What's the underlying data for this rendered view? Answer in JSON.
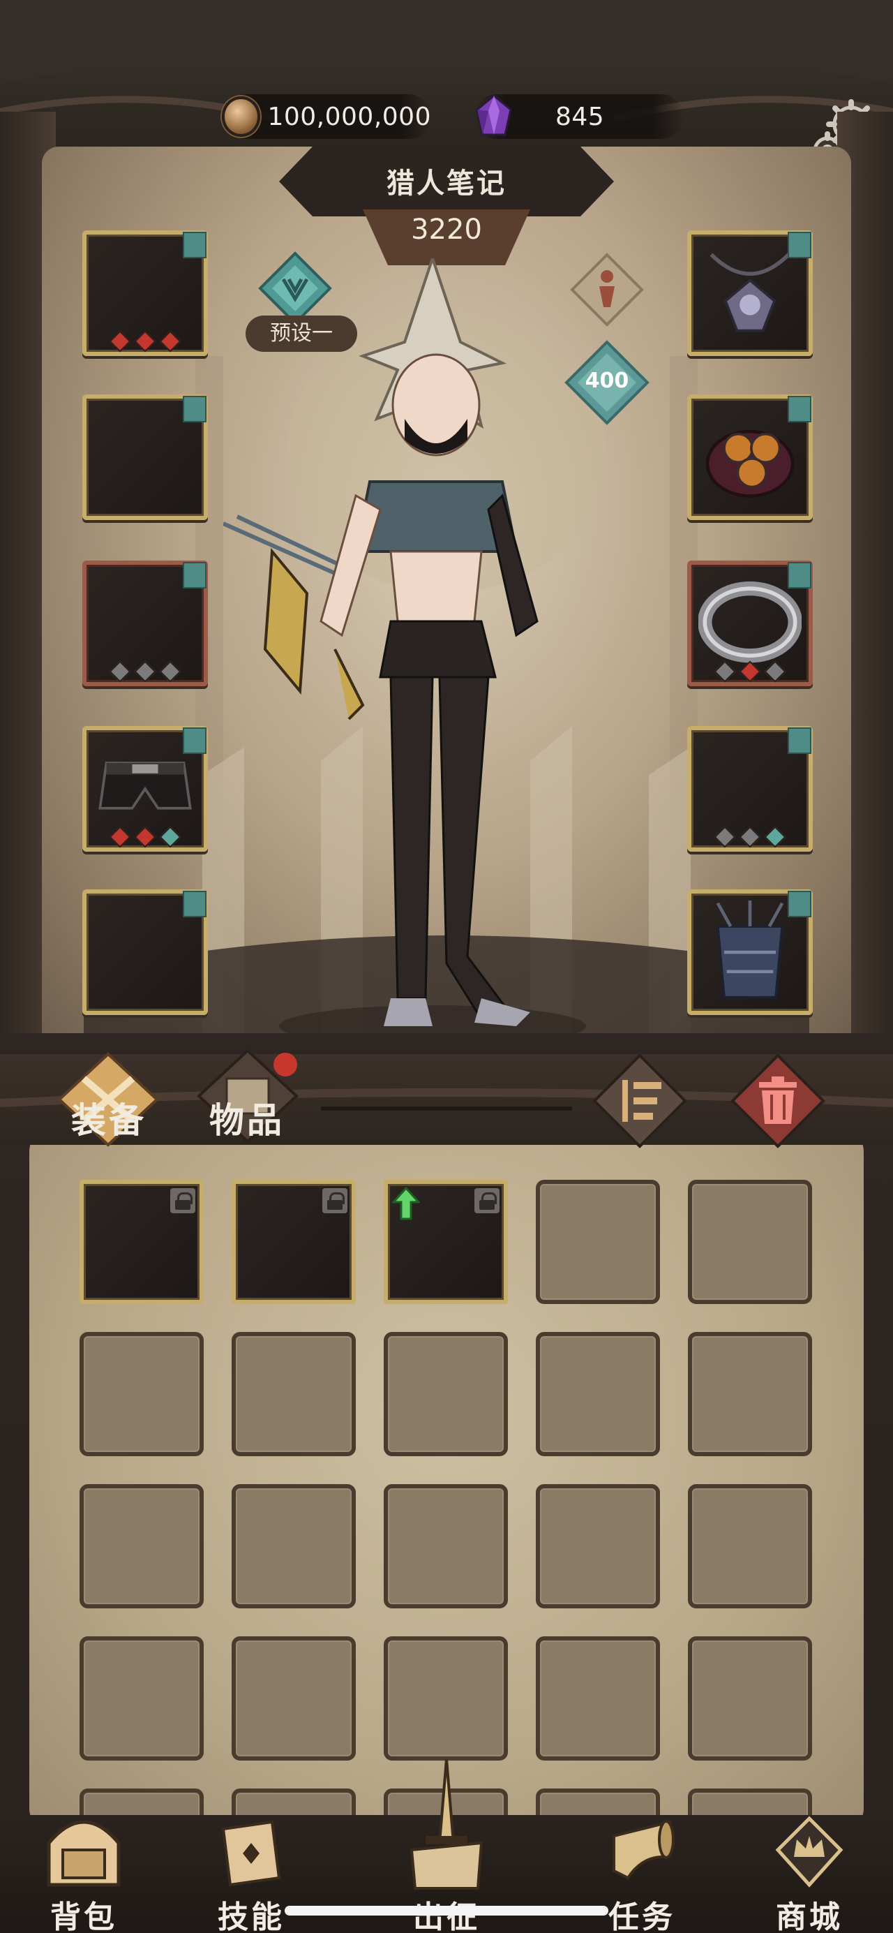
{
  "currency": {
    "gold": "100,000,000",
    "gems": "845"
  },
  "header": {
    "title": "猎人笔记",
    "score": "3220"
  },
  "preset": {
    "label": "预设一"
  },
  "power": {
    "value": "400"
  },
  "tabs": {
    "equipment": "装备",
    "items": "物品"
  },
  "bottom_nav": [
    {
      "label": "背包",
      "icon": "backpack-icon"
    },
    {
      "label": "技能",
      "icon": "skill-book-icon"
    },
    {
      "label": "出征",
      "icon": "sword-banner-icon"
    },
    {
      "label": "任务",
      "icon": "horn-icon"
    },
    {
      "label": "商城",
      "icon": "shop-crown-icon"
    }
  ],
  "colors": {
    "gold_frame": "#c6ad6a",
    "accent_teal": "#4f8c86",
    "gem_red": "#c4372f",
    "notification_red": "#c7372c"
  }
}
